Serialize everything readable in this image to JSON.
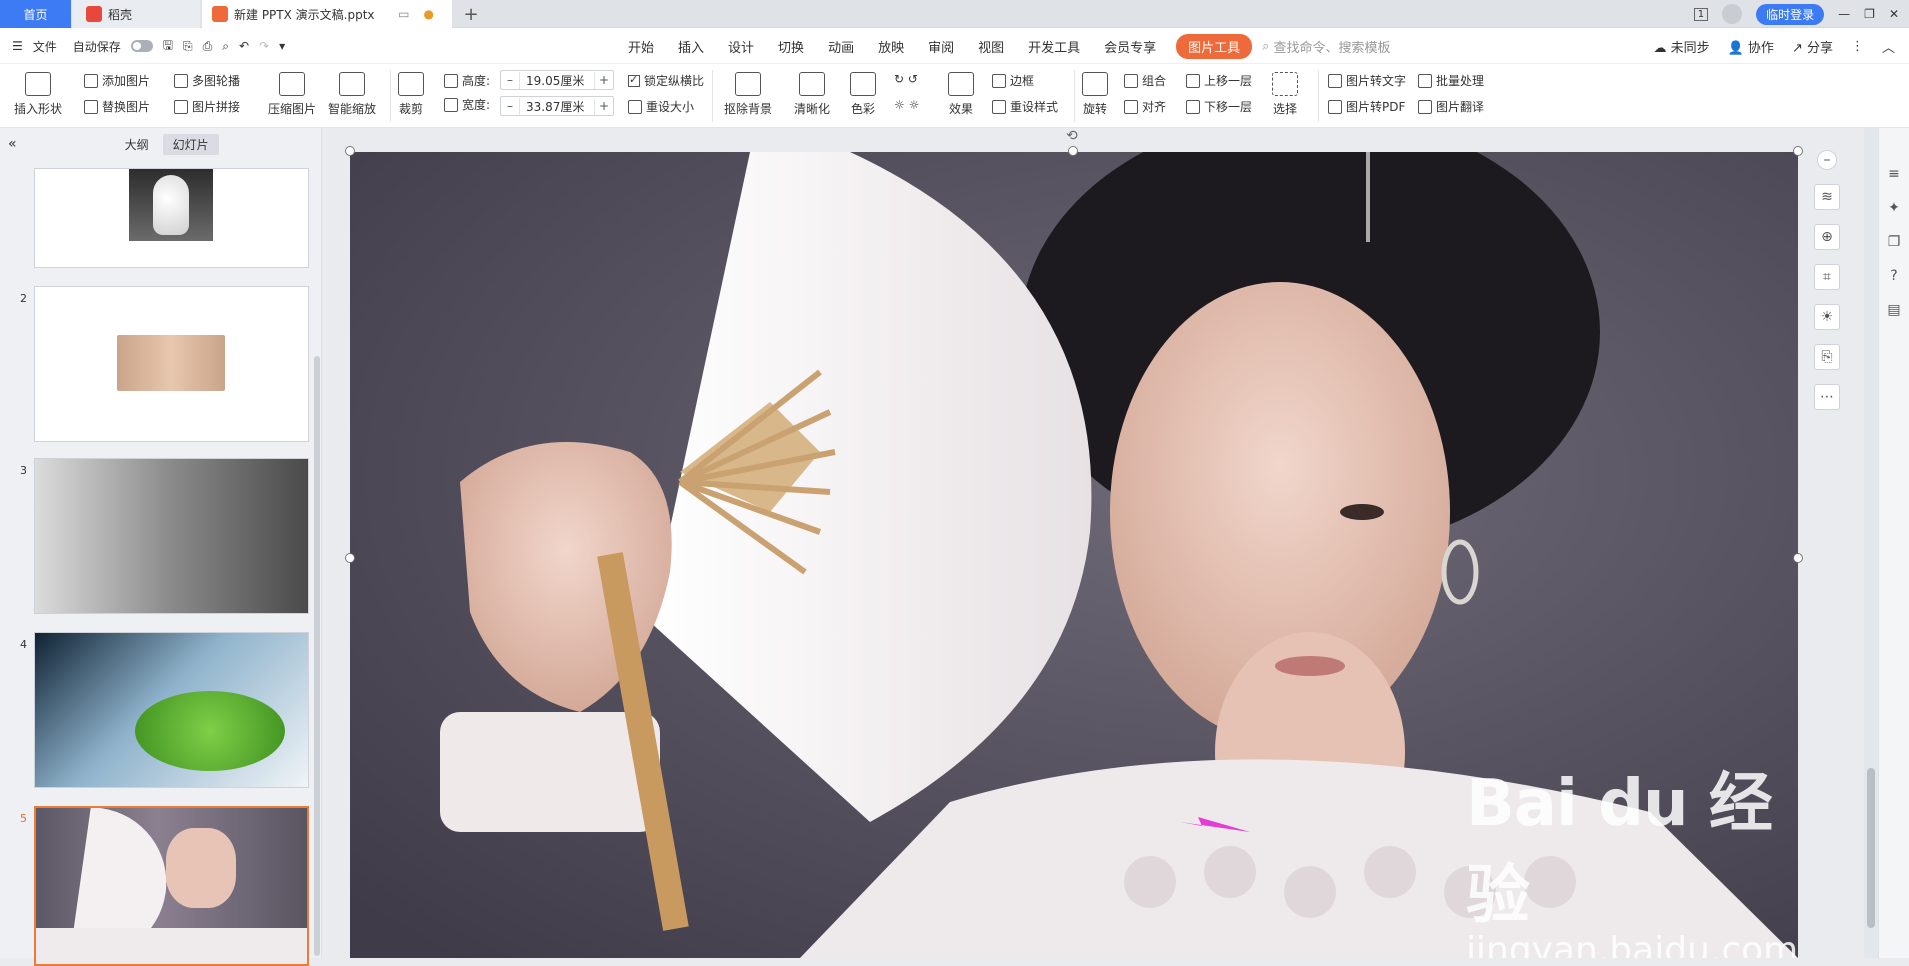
{
  "titlebar": {
    "home_tab": "首页",
    "daoke_tab": "稻壳",
    "doc_tab": "新建 PPTX 演示文稿.pptx",
    "new_tab_symbol": "+",
    "login_button": "临时登录"
  },
  "menubar": {
    "file": "文件",
    "autosave": "自动保存",
    "tabs": [
      "开始",
      "插入",
      "设计",
      "切换",
      "动画",
      "放映",
      "审阅",
      "视图",
      "开发工具",
      "会员专享"
    ],
    "active_tab": "图片工具",
    "search_placeholder": "查找命令、搜索模板",
    "sync": "未同步",
    "collab": "协作",
    "share": "分享"
  },
  "ribbon": {
    "insert_shape": "插入形状",
    "add_picture": "添加图片",
    "replace_picture": "替换图片",
    "multi_outline": "多图轮播",
    "picture_collage": "图片拼接",
    "compress": "压缩图片",
    "smart_zoom": "智能缩放",
    "crop": "裁剪",
    "height_label": "高度:",
    "height_value": "19.05厘米",
    "width_label": "宽度:",
    "width_value": "33.87厘米",
    "lock_ratio": "锁定纵横比",
    "reset_size": "重设大小",
    "remove_bg": "抠除背景",
    "clarify": "清晰化",
    "color": "色彩",
    "effects": "效果",
    "border": "边框",
    "reset_style": "重设样式",
    "rotate": "旋转",
    "group": "组合",
    "align": "对齐",
    "bring_forward": "上移一层",
    "send_backward": "下移一层",
    "select": "选择",
    "pic_to_text": "图片转文字",
    "batch": "批量处理",
    "pic_to_pdf": "图片转PDF",
    "pic_translate": "图片翻译"
  },
  "leftpanel": {
    "outline_tab": "大纲",
    "slides_tab": "幻灯片",
    "slide_numbers": [
      "2",
      "3",
      "4",
      "5"
    ]
  },
  "watermark": {
    "big": "Bai du 经验",
    "small": "jingyan.baidu.com"
  },
  "colors": {
    "accent_blue": "#3d7bf5",
    "accent_orange": "#ee6a3a",
    "arrow_magenta": "#e63cd6"
  }
}
